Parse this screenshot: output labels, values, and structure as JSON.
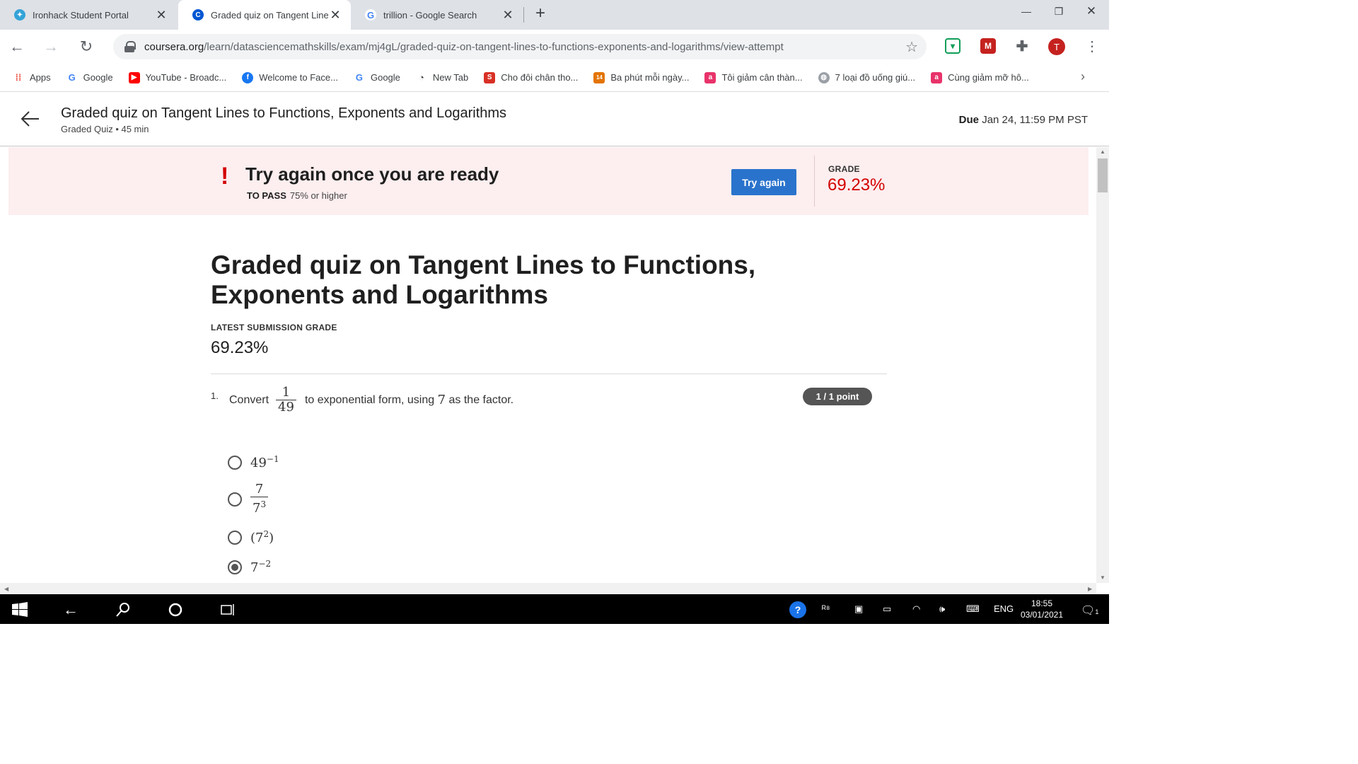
{
  "browser": {
    "tabs": [
      {
        "title": "Ironhack Student Portal",
        "favicon": "ironhack-icon",
        "active": false
      },
      {
        "title": "Graded quiz on Tangent Lines t",
        "favicon": "coursera-icon",
        "active": true
      },
      {
        "title": "trillion - Google Search",
        "favicon": "google-icon",
        "active": false
      }
    ],
    "new_tab": "+",
    "url_host": "coursera.org",
    "url_path": "/learn/datasciencemathskills/exam/mj4gL/graded-quiz-on-tangent-lines-to-functions-exponents-and-logarithms/view-attempt",
    "profile_initial": "T"
  },
  "bookmarks": [
    {
      "label": "Apps",
      "icon": "apps-grid-icon"
    },
    {
      "label": "Google",
      "icon": "google-icon"
    },
    {
      "label": "YouTube - Broadc...",
      "icon": "youtube-icon"
    },
    {
      "label": "Welcome to Face...",
      "icon": "facebook-icon"
    },
    {
      "label": "Google",
      "icon": "google-icon"
    },
    {
      "label": "New Tab",
      "icon": "newtab-icon"
    },
    {
      "label": "Cho đôi chân tho...",
      "icon": "s-icon"
    },
    {
      "label": "Ba phút mỗi ngày...",
      "icon": "calendar-14-icon"
    },
    {
      "label": "Tôi giảm cân thàn...",
      "icon": "a-icon"
    },
    {
      "label": "7 loại đồ uống giú...",
      "icon": "globe-icon"
    },
    {
      "label": "Cùng giảm mỡ hô...",
      "icon": "a-icon"
    }
  ],
  "header": {
    "title": "Graded quiz on Tangent Lines to Functions, Exponents and Logarithms",
    "subtitle": "Graded Quiz • 45 min",
    "due_label": "Due",
    "due_value": "Jan 24, 11:59 PM PST"
  },
  "banner": {
    "icon": "!",
    "title": "Try again once you are ready",
    "pass_label": "TO PASS",
    "pass_value": "75% or higher",
    "button": "Try again",
    "grade_label": "GRADE",
    "grade_value": "69.23%"
  },
  "main": {
    "title": "Graded quiz on Tangent Lines to Functions, Exponents and Logarithms",
    "submission_label": "LATEST SUBMISSION GRADE",
    "submission_grade": "69.23%"
  },
  "question": {
    "number": "1.",
    "prefix": "Convert",
    "frac_num": "1",
    "frac_den": "49",
    "middle": "to exponential form, using",
    "factor": "7",
    "suffix": "as the factor.",
    "points": "1 / 1 point",
    "options": [
      {
        "base": "49",
        "exp": "−1",
        "selected": false
      },
      {
        "num": "7",
        "den_base": "7",
        "den_exp": "3",
        "selected": false
      },
      {
        "open": "(",
        "base": "7",
        "exp": "2",
        "close": ")",
        "selected": false
      },
      {
        "base": "7",
        "exp": "−2",
        "selected": true
      }
    ]
  },
  "taskbar": {
    "language": "ENG",
    "time": "18:55",
    "date": "03/01/2021",
    "notification_count": "1"
  }
}
